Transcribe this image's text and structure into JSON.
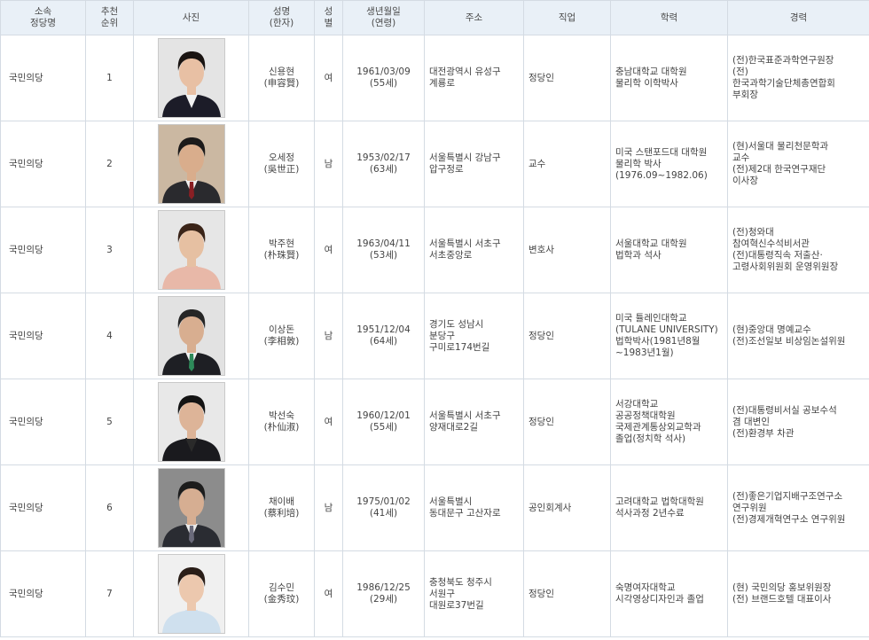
{
  "headers": {
    "party": "소속\n정당명",
    "rank": "추천\n순위",
    "photo": "사진",
    "name": "성명\n(한자)",
    "gender": "성\n별",
    "birth": "생년월일\n(연령)",
    "address": "주소",
    "job": "직업",
    "education": "학력",
    "career": "경력"
  },
  "rows": [
    {
      "party": "국민의당",
      "rank": "1",
      "name": "신용현\n(申容賢)",
      "gender": "여",
      "birth": "1961/03/09\n(55세)",
      "address": "대전광역시 유성구\n계룡로",
      "job": "정당인",
      "education": "충남대학교 대학원\n물리학 이학박사",
      "career": "(전)한국표준과학연구원장\n(전)\n한국과학기술단체총연합회\n부회장",
      "photo": {
        "bg": "#e4e4e4",
        "suit": "#1c1c28",
        "shirt": "#f2f2f2",
        "hair": "#1a1412",
        "skin": "#e8c0a4",
        "tie": ""
      }
    },
    {
      "party": "국민의당",
      "rank": "2",
      "name": "오세정\n(吳世正)",
      "gender": "남",
      "birth": "1953/02/17\n(63세)",
      "address": "서울특별시 강남구\n압구정로",
      "job": "교수",
      "education": "미국 스탠포드대 대학원\n물리학 박사\n(1976.09~1982.06)",
      "career": "(현)서울대 물리천문학과\n교수\n(전)제2대 한국연구재단\n이사장",
      "photo": {
        "bg": "#cbb8a2",
        "suit": "#2a2a2e",
        "shirt": "#efefef",
        "hair": "#1c1a1a",
        "skin": "#d9ad8c",
        "tie": "#8a1f24"
      }
    },
    {
      "party": "국민의당",
      "rank": "3",
      "name": "박주현\n(朴珠賢)",
      "gender": "여",
      "birth": "1963/04/11\n(53세)",
      "address": "서울특별시 서초구\n서초중앙로",
      "job": "변호사",
      "education": "서울대학교 대학원\n법학과 석사",
      "career": "(전)청와대\n참여혁신수석비서관\n(전)대통령직속 저출산·\n고령사회위원회 운영위원장",
      "photo": {
        "bg": "#e6e6e6",
        "suit": "#e8b8a8",
        "shirt": "#e8b8a8",
        "hair": "#3a2418",
        "skin": "#e6c0a2",
        "tie": ""
      }
    },
    {
      "party": "국민의당",
      "rank": "4",
      "name": "이상돈\n(李相敦)",
      "gender": "남",
      "birth": "1951/12/04\n(64세)",
      "address": "경기도 성남시\n분당구\n구미로174번길",
      "job": "정당인",
      "education": "미국 튤레인대학교\n(TULANE UNIVERSITY)\n법학박사(1981년8월\n~1983년1월)",
      "career": "(현)중앙대 명예교수\n(전)조선일보 비상임논설위원",
      "photo": {
        "bg": "#e2e2e2",
        "suit": "#1e1f24",
        "shirt": "#f2f2f2",
        "hair": "#262626",
        "skin": "#d8ae90",
        "tie": "#2e8a5a"
      }
    },
    {
      "party": "국민의당",
      "rank": "5",
      "name": "박선숙\n(朴仙淑)",
      "gender": "여",
      "birth": "1960/12/01\n(55세)",
      "address": "서울특별시 서초구\n양재대로2길",
      "job": "정당인",
      "education": "서강대학교\n공공정책대학원\n국제관계통상외교학과\n졸업(정치학 석사)",
      "career": "(전)대통령비서실 공보수석\n겸 대변인\n(전)환경부 차관",
      "photo": {
        "bg": "#e8e8e8",
        "suit": "#1a1a1e",
        "shirt": "#2a2a2a",
        "hair": "#141414",
        "skin": "#ddb498",
        "tie": ""
      }
    },
    {
      "party": "국민의당",
      "rank": "6",
      "name": "채이배\n(蔡利培)",
      "gender": "남",
      "birth": "1975/01/02\n(41세)",
      "address": "서울특별시\n동대문구 고산자로",
      "job": "공인회계사",
      "education": "고려대학교 법학대학원\n석사과정 2년수료",
      "career": "(전)좋은기업지배구조연구소\n연구위원\n(전)경제개혁연구소 연구위원",
      "photo": {
        "bg": "#8c8c8c",
        "suit": "#2a2c32",
        "shirt": "#eaeaea",
        "hair": "#1c1c1c",
        "skin": "#d6ae92",
        "tie": "#6a6a7a"
      }
    },
    {
      "party": "국민의당",
      "rank": "7",
      "name": "김수민\n(金秀玟)",
      "gender": "여",
      "birth": "1986/12/25\n(29세)",
      "address": "충청북도 청주시\n서원구\n대원로37번길",
      "job": "정당인",
      "education": "숙명여자대학교\n시각영상디자인과 졸업",
      "career": "(현) 국민의당 홍보위원장\n(전) 브랜드호텔 대표이사",
      "photo": {
        "bg": "#f0f0f0",
        "suit": "#cfe0ee",
        "shirt": "#cfe0ee",
        "hair": "#2a1e18",
        "skin": "#ecc8ae",
        "tie": ""
      }
    }
  ]
}
